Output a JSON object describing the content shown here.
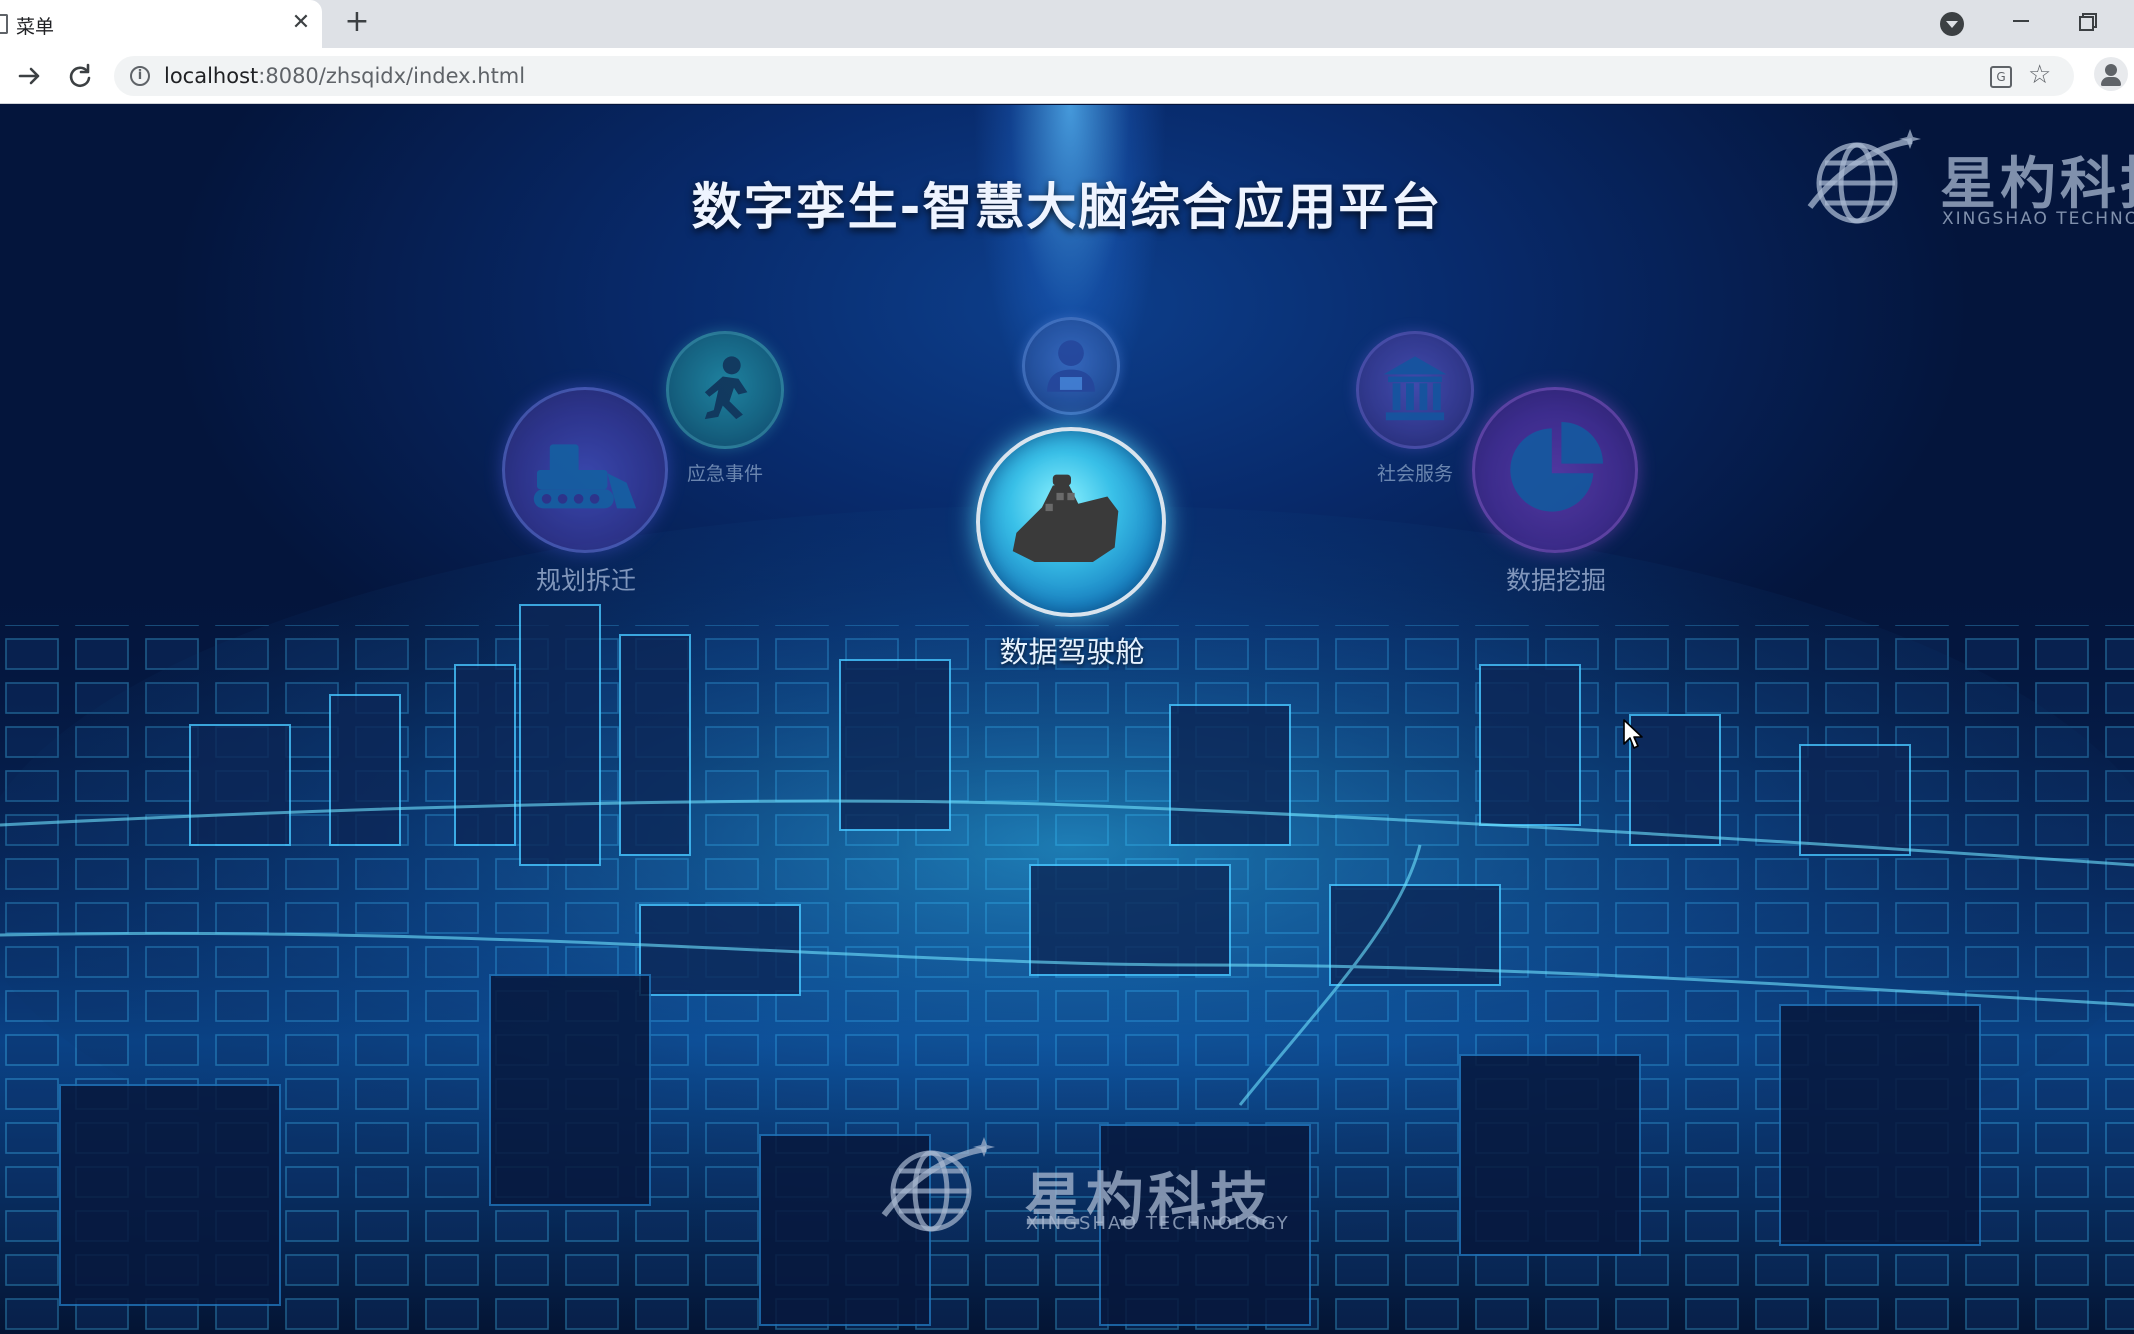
{
  "browser": {
    "tab_title": "菜单",
    "tab_close": "✕",
    "new_tab": "+",
    "url_host": "localhost",
    "url_path": ":8080/zhsqidx/index.html"
  },
  "page": {
    "title": "数字孪生-智慧大脑综合应用平台"
  },
  "brand": {
    "name": "星杓科技",
    "sub": "XINGSHAO TECHNOLOGY"
  },
  "menu": [
    {
      "id": "planning",
      "label": "规划拆迁",
      "icon": "bulldozer-icon"
    },
    {
      "id": "emergency",
      "label": "应急事件",
      "icon": "running-person-icon"
    },
    {
      "id": "personnel",
      "label": "",
      "icon": "person-icon"
    },
    {
      "id": "cockpit",
      "label": "数据驾驶舱",
      "icon": "ship-icon"
    },
    {
      "id": "social",
      "label": "社会服务",
      "icon": "institution-icon"
    },
    {
      "id": "mining",
      "label": "数据挖掘",
      "icon": "pie-chart-icon"
    }
  ]
}
